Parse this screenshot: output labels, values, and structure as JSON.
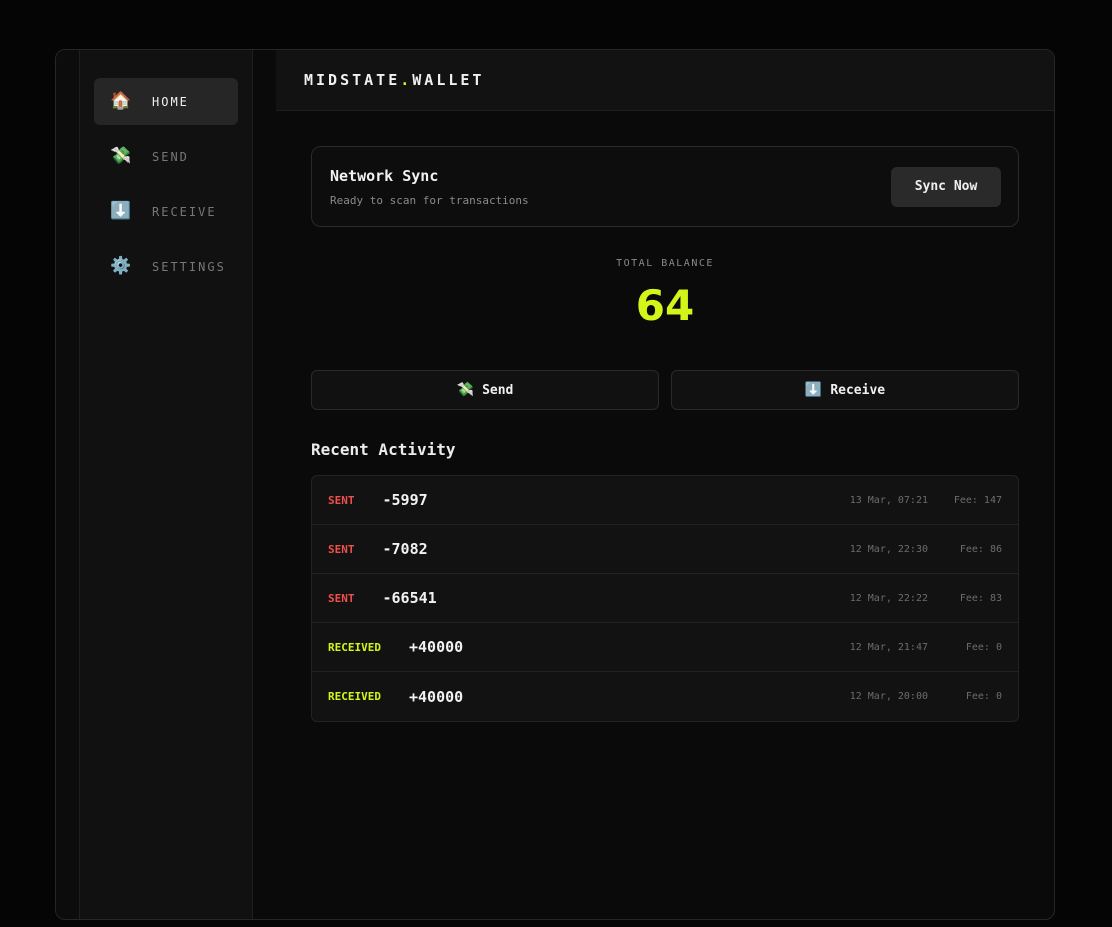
{
  "brand": {
    "name": "MIDSTATE",
    "dot": ".",
    "suffix": "WALLET"
  },
  "sidebar": {
    "items": [
      {
        "icon": "🏠",
        "icon_name": "home-icon",
        "label": "HOME",
        "active": true
      },
      {
        "icon": "💸",
        "icon_name": "money-wings-icon",
        "label": "SEND",
        "active": false
      },
      {
        "icon": "⬇️",
        "icon_name": "down-arrow-icon",
        "label": "RECEIVE",
        "active": false
      },
      {
        "icon": "⚙️",
        "icon_name": "gear-icon",
        "label": "SETTINGS",
        "active": false
      }
    ]
  },
  "sync": {
    "title": "Network Sync",
    "subtitle": "Ready to scan for transactions",
    "button_label": "Sync Now"
  },
  "balance": {
    "label": "TOTAL BALANCE",
    "value": "64"
  },
  "actions": {
    "send": {
      "icon": "💸",
      "label": "Send"
    },
    "receive": {
      "icon": "⬇️",
      "label": "Receive"
    }
  },
  "activity": {
    "title": "Recent Activity",
    "transactions": [
      {
        "type": "SENT",
        "amount": "-5997",
        "date": "13 Mar, 07:21",
        "fee": "Fee: 147"
      },
      {
        "type": "SENT",
        "amount": "-7082",
        "date": "12 Mar, 22:30",
        "fee": "Fee: 86"
      },
      {
        "type": "SENT",
        "amount": "-66541",
        "date": "12 Mar, 22:22",
        "fee": "Fee: 83"
      },
      {
        "type": "RECEIVED",
        "amount": "+40000",
        "date": "12 Mar, 21:47",
        "fee": "Fee: 0"
      },
      {
        "type": "RECEIVED",
        "amount": "+40000",
        "date": "12 Mar, 20:00",
        "fee": "Fee: 0"
      }
    ]
  },
  "colors": {
    "accent": "#d4f51a",
    "sent": "#f0504a",
    "received": "#d4f51a",
    "background": "#0a0a0a"
  }
}
